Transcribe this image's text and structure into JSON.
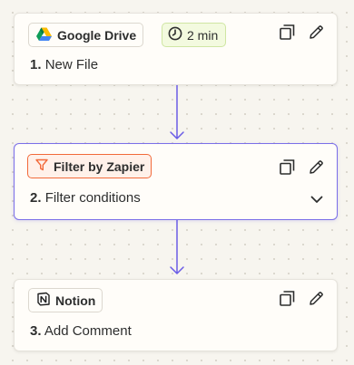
{
  "colors": {
    "canvas": "#f7f5ef",
    "active_border": "#7a6ee8",
    "connector": "#6a5ce6",
    "filter_accent": "#f26a3a",
    "time_badge_bg": "#f3fadf"
  },
  "steps": [
    {
      "number": "1.",
      "title": "New File",
      "app": "Google Drive",
      "app_icon": "google-drive-icon",
      "time": "2 min",
      "time_icon": "clock-icon"
    },
    {
      "number": "2.",
      "title": "Filter conditions",
      "app": "Filter by Zapier",
      "app_icon": "filter-icon",
      "expand_icon": "chevron-down-icon"
    },
    {
      "number": "3.",
      "title": "Add Comment",
      "app": "Notion",
      "app_icon": "notion-icon"
    }
  ],
  "actions": {
    "copy_icon": "copy-icon",
    "edit_icon": "edit-pencil-icon"
  }
}
